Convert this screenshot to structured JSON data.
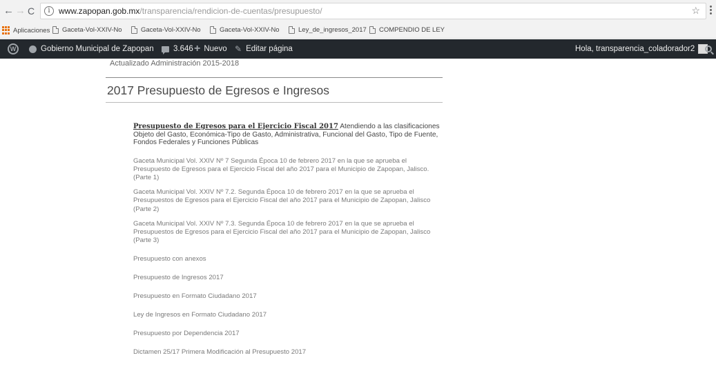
{
  "browser": {
    "nav": {
      "back": "←",
      "forward": "→",
      "reload": "C"
    },
    "url_host": "www.zapopan.gob.mx",
    "url_path": "/transparencia/rendicion-de-cuentas/presupuesto/",
    "star": "☆",
    "bookmarks": [
      "Aplicaciones",
      "Gaceta-Vol-XXIV-No",
      "Gaceta-Vol-XXIV-No",
      "Gaceta-Vol-XXIV-No",
      "Ley_de_ingresos_2017",
      "COMPENDIO DE LEY"
    ]
  },
  "admin_bar": {
    "site_name": "Gobierno Municipal de Zapopan",
    "comments_count": "3.646",
    "new_label": "Nuevo",
    "edit_label": "Editar página",
    "greeting": "Hola, transparencia_coladorador2"
  },
  "page": {
    "updated": "Actualizado Administración 2015-2018",
    "section_title": "2017 Presupuesto de Egresos e Ingresos",
    "main_link": "Presupuesto de Egresos para el Ejercicio Fiscal 2017",
    "main_text": " Atendiendo a las clasificaciones Objeto del Gasto, Económica-Tipo de Gasto, Administrativa, Funcional del Gasto, Tipo de Fuente, Fondos Federales y Funciones Públicas",
    "gacetas": [
      "Gaceta Municipal Vol. XXIV Nº 7 Segunda Época 10 de febrero 2017 en la que se aprueba el Presupuesto de Egresos para el Ejercicio Fiscal del año 2017  para el Municipio de Zapopan, Jalisco. (Parte 1)",
      "Gaceta Municipal Vol. XXIV Nº 7.2. Segunda Época 10 de febrero 2017 en la que se aprueba el Presupuestos de Egresos para el Ejercicio Fiscal del año 2017 para el Municipio de Zapopan, Jalisco (Parte 2)",
      "Gaceta Municipal Vol. XXIV Nº 7.3. Segunda Época 10 de febrero 2017 en la que se aprueba el Presupuestos de Egresos para el Ejercicio Fiscal del año 2017 para el Municipio de Zapopan, Jalisco (Parte 3)"
    ],
    "links": [
      "Presupuesto con anexos",
      "Presupuesto de Ingresos 2017",
      "Presupuesto en Formato Ciudadano 2017",
      "Ley de Ingresos en Formato Ciudadano 2017",
      "Presupuesto por Dependencia 2017",
      "Dictamen 25/17 Primera Modificación al Presupuesto 2017"
    ]
  },
  "icons": {
    "info": "info-icon",
    "star": "star-icon",
    "wordpress": "wordpress-logo-icon",
    "comments": "comment-icon",
    "new": "plus-icon",
    "edit": "pencil-icon",
    "search": "search-icon"
  },
  "colors": {
    "admin_bar_bg": "#23282d",
    "bookmark_bar_bg": "#f2f2f2",
    "apps_grid": "#e8710a"
  }
}
